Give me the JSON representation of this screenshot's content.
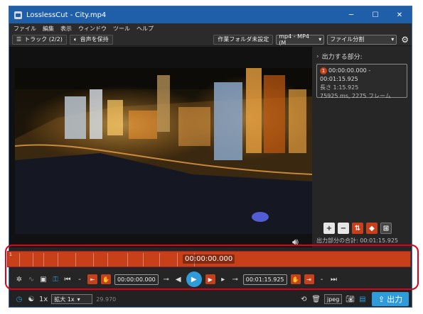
{
  "window": {
    "title": "LosslessCut - City.mp4",
    "minimize": "─",
    "maximize": "☐",
    "close": "✕"
  },
  "menu": [
    "ファイル",
    "編集",
    "表示",
    "ウィンドウ",
    "ツール",
    "ヘルプ"
  ],
  "toolbar": {
    "tracks_label": "トラック (2/2)",
    "audio_label": "音声を保持",
    "workdir_label": "作業フォルダ未設定",
    "format_value": "mp4 - MP4 (M",
    "mode_value": "ファイル分割"
  },
  "right_panel": {
    "heading": "出力する部分:",
    "segment": {
      "number": "1",
      "range": "00:00:00.000 - 00:01:15.925",
      "length": "長さ 1:15.925",
      "frames": "75925 ms, 2275 フレーム"
    },
    "total_label": "出力部分の合計:",
    "total_value": "00:01:15.925",
    "icon_colors": {
      "add": "#e6e6e6",
      "remove": "#e6e6e6",
      "reorder": "#c8401a",
      "tag": "#c8401a",
      "split": "#c8401a"
    }
  },
  "timeline": {
    "current_time": "00:00:00.000",
    "start_marker": "1",
    "accent": "#c8401a"
  },
  "controls": {
    "start_time": "00:00:00.000",
    "end_time": "00:01:15.925",
    "dash1": "-",
    "dash2": "-"
  },
  "bottom": {
    "speed": "1x",
    "zoom_value": "拡大 1x",
    "fps": "29.970",
    "capture_format": "jpeg",
    "export_label": "出力"
  }
}
